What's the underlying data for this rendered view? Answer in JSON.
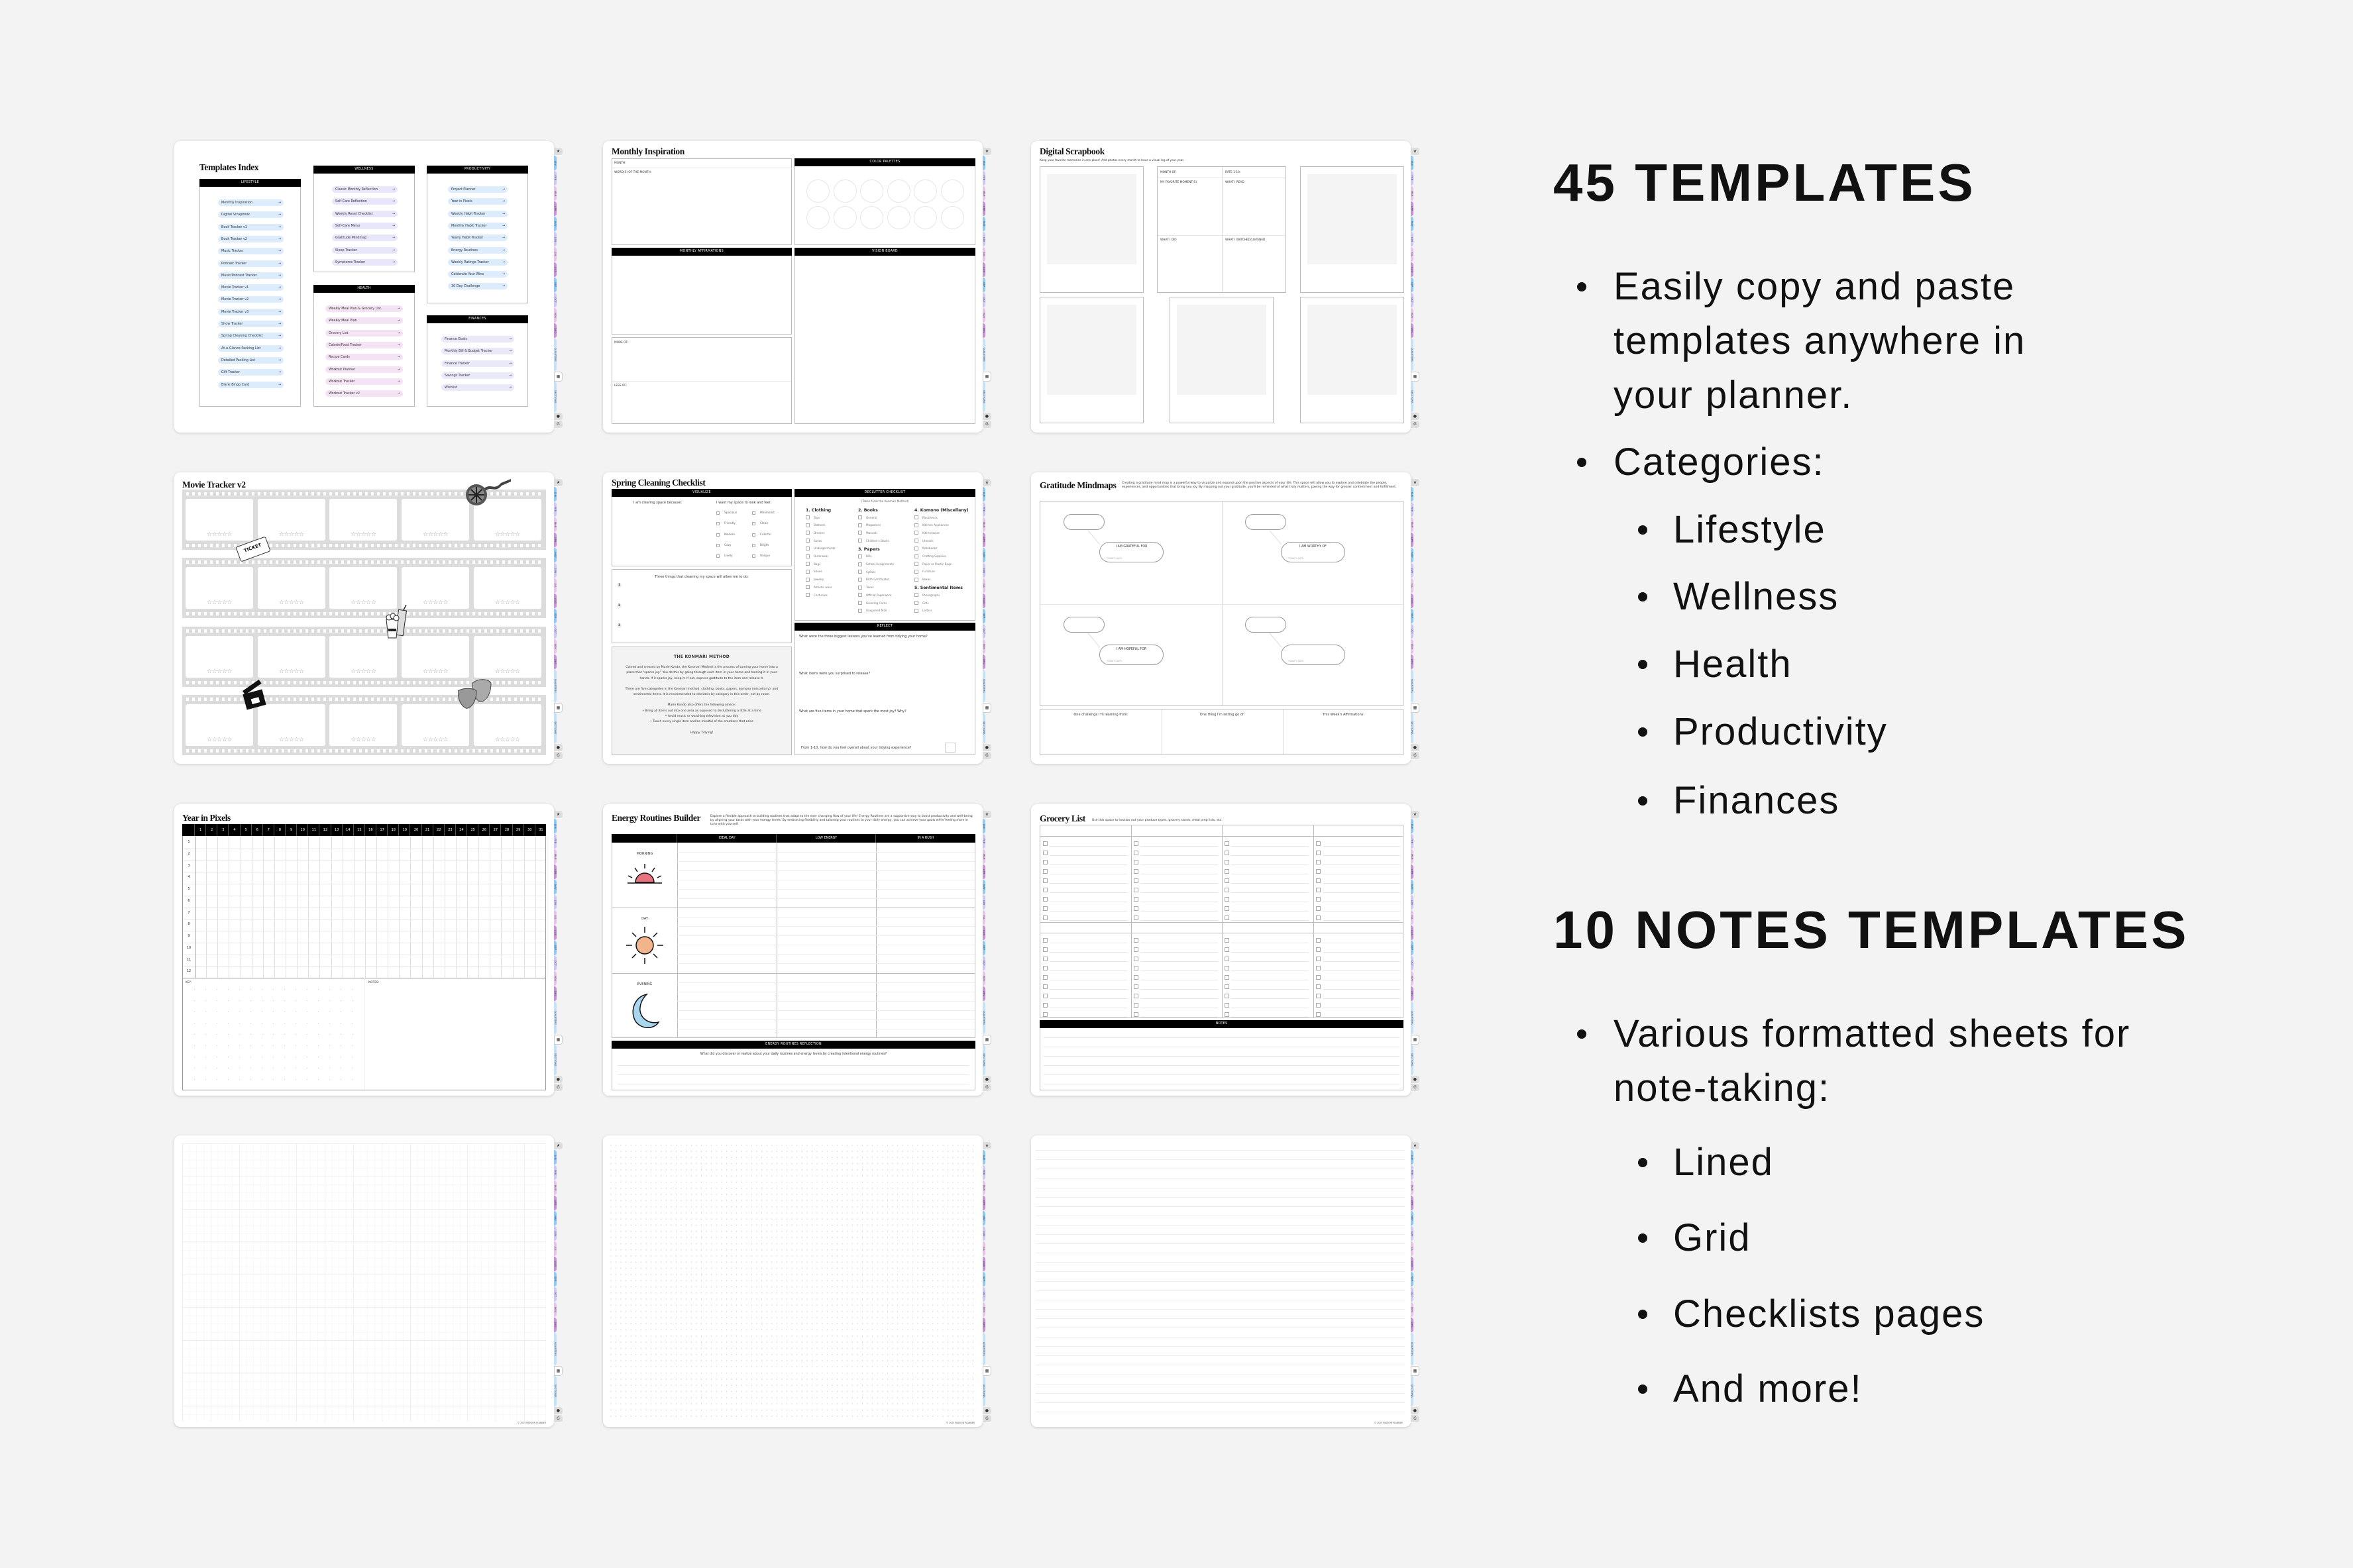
{
  "marketing": {
    "heading_templates": "45 TEMPLATES",
    "bullet_copy_paste": "Easily copy and paste templates anywhere in your planner.",
    "bullet_categories": "Categories:",
    "categories": [
      "Lifestyle",
      "Wellness",
      "Health",
      "Productivity",
      "Finances"
    ],
    "heading_notes": "10 NOTES TEMPLATES",
    "bullet_notes": "Various formatted sheets for note-taking:",
    "notes_types": [
      "Lined",
      "Grid",
      "Checklists pages",
      "And more!"
    ]
  },
  "page_tabs": [
    {
      "label": "",
      "icon": "star-icon",
      "glyph": "★",
      "color": "#dedede"
    },
    {
      "label": "JAN",
      "color": "#8fc9f4"
    },
    {
      "label": "FEB",
      "color": "#cdc8f6"
    },
    {
      "label": "MAR",
      "color": "#e7c4e8"
    },
    {
      "label": "APR",
      "color": "#c892d8"
    },
    {
      "label": "MAY",
      "color": "#8fc9f4"
    },
    {
      "label": "JUN",
      "color": "#cdc8f6"
    },
    {
      "label": "JUL",
      "color": "#e7c4e8"
    },
    {
      "label": "AUG",
      "color": "#c892d8"
    },
    {
      "label": "SEP",
      "color": "#8fc9f4"
    },
    {
      "label": "OCT",
      "color": "#cdc8f6"
    },
    {
      "label": "NOV",
      "color": "#e7c4e8"
    },
    {
      "label": "DEC",
      "color": "#c892d8"
    },
    {
      "label": "QUARTERS",
      "color": "#c4e2f8"
    },
    {
      "label": "",
      "icon": "table-icon",
      "glyph": "▦",
      "color": "#ffffff"
    },
    {
      "label": "SECTIONS",
      "color": "#c4e2f8"
    },
    {
      "label": "",
      "icon": "apple-icon",
      "glyph": "●",
      "color": "#dedede"
    },
    {
      "label": "",
      "icon": "google-icon",
      "glyph": "G",
      "color": "#dedede"
    }
  ],
  "templates_index": {
    "title": "Templates Index",
    "sections": [
      {
        "name": "LIFESTYLE",
        "color": "#dcecfc",
        "items": [
          "Monthly Inspiration",
          "Digital Scrapbook",
          "Book Tracker v1",
          "Book Tracker v2",
          "Music Tracker",
          "Podcast Tracker",
          "Music/Podcast Tracker",
          "Movie Tracker v1",
          "Movie Tracker v2",
          "Movie Tracker v3",
          "Show Tracker",
          "Spring Cleaning Checklist",
          "At-a-Glance Packing List",
          "Detailed Packing List",
          "Gift Tracker",
          "Blank Bingo Card"
        ]
      },
      {
        "name": "WELLNESS",
        "color": "#e8e6fb",
        "items": [
          "Classic Monthly Reflection",
          "Self-Care Reflection",
          "Weekly Reset Checklist",
          "Self-Care Menu",
          "Gratitude Mindmap",
          "Sleep Tracker",
          "Symptoms Tracker"
        ]
      },
      {
        "name": "HEALTH",
        "color": "#f4e3f4",
        "items": [
          "Weekly Meal Plan & Grocery List",
          "Weekly Meal Plan",
          "Grocery List",
          "Calorie/Food Tracker",
          "Recipe Cards",
          "Workout Planner",
          "Workout Tracker",
          "Workout Tracker v2"
        ]
      },
      {
        "name": "PRODUCTIVITY",
        "color": "#dcecfc",
        "items": [
          "Project Planner",
          "Year in Pixels",
          "Weekly Habit Tracker",
          "Monthly Habit Tracker",
          "Yearly Habit Tracker",
          "Energy Routines",
          "Weekly Ratings Tracker",
          "Celebrate Your Wins",
          "30 Day Challenge"
        ]
      },
      {
        "name": "FINANCES",
        "color": "#e9e9fa",
        "items": [
          "Finance Goals",
          "Monthly Bill & Budget Tracker",
          "Finance Tracker",
          "Savings Tracker",
          "Wishlist"
        ]
      }
    ]
  },
  "monthly_inspiration": {
    "title": "Monthly Inspiration",
    "month_label": "MONTH:",
    "words_label": "WORD(S) OF THE MONTH:",
    "palettes_header": "COLOR PALETTES",
    "affirmations_header": "MONTHLY AFFIRMATIONS",
    "vision_header": "VISION BOARD",
    "more_label": "MORE OF:",
    "less_label": "LESS OF:"
  },
  "digital_scrapbook": {
    "title": "Digital Scrapbook",
    "subtitle": "Keep your favorite memories in one place! Add photos every month to have a visual log of your year.",
    "month_of": "MONTH OF:",
    "rate": "RATE 1-10:",
    "favorite": "MY FAVORITE MOMENT(S)",
    "read": "WHAT I READ",
    "did": "WHAT I DID",
    "watched": "WHAT I WATCHED/LISTENED"
  },
  "movie_tracker": {
    "title": "Movie Tracker v2",
    "ticket_label": "TICKET",
    "stars": "☆☆☆☆☆"
  },
  "spring_cleaning": {
    "title": "Spring Cleaning Checklist",
    "visualize_header": "VISUALIZE",
    "clearing_prompt": "I am clearing space because:",
    "look_prompt": "I want my space to look and feel:",
    "feel_options": [
      "Spacious",
      "Minimalist",
      "Friendly",
      "Clean",
      "Modern",
      "Colorful",
      "Cozy",
      "Bright",
      "Lively",
      "Unique"
    ],
    "three_things_prompt": "Three things that cleaning my space will allow me to do:",
    "numbers": [
      "1",
      "2",
      "3"
    ],
    "konmari_title": "THE KONMARI METHOD",
    "konmari_paragraphs": [
      "Coined and created by Marie Kondo, the Konmari Method is the process of turning your home into a place that \"sparks joy.\" You do this by going through each item in your home and holding it in your hands. If it sparks joy, keep it. If not, express gratitude to the item and release it.",
      "There are five categories in the Konmari method: clothing, books, papers, komono (miscellany), and sentimental items. It is recommended to declutter by category in this order, not by room.",
      "Marie Kondo also offers the following advice:\n• Bring all items out into one area as opposed to decluttering a little at a time\n• Avoid music or watching television as you tidy\n• Touch every single item and be mindful of the emotions that arise",
      "Happy Tidying!"
    ],
    "declutter_header": "DECLUTTER CHECKLIST",
    "declutter_note": "(Taken from the Konmari Method)",
    "categories": [
      {
        "name": "1. Clothing",
        "items": [
          "Tops",
          "Bottoms",
          "Dresses",
          "Socks",
          "Undergarments",
          "Outerwear",
          "Bags",
          "Shoes",
          "Jewelry",
          "Athletic wear",
          "Costumes"
        ]
      },
      {
        "name": "2. Books",
        "items": [
          "General",
          "Magazines",
          "Manuals",
          "Children's Books"
        ]
      },
      {
        "name": "3. Papers",
        "items": [
          "Bills",
          "School Assignments",
          "Syllabi",
          "Birth Certificates",
          "Taxes",
          "Official Paperwork",
          "Greeting Cards",
          "Unopened Mail"
        ]
      },
      {
        "name": "4. Komono (Miscellany)",
        "items": [
          "Electronics",
          "Kitchen Appliances",
          "Kitchenware",
          "Utensils",
          "Notebooks",
          "Crafting Supplies",
          "Paper or Plastic Bags",
          "Furniture",
          "Boxes"
        ]
      },
      {
        "name": "5. Sentimental Items",
        "items": [
          "Photographs",
          "Gifts",
          "Letters"
        ]
      }
    ],
    "reflect_header": "REFLECT",
    "reflect_questions": [
      "What were the three biggest lessons you've learned from tidying your home?",
      "What items were you surprised to release?",
      "What are five items in your home that spark the most joy? Why?",
      "From 1-10, how do you feel overall about your tidying experience?"
    ]
  },
  "gratitude": {
    "title": "Gratitude Mindmaps",
    "description": "Creating a gratitude mind map is a powerful way to visualize and expand upon the positive aspects of your life. This space will allow you to explore and celebrate the people, experiences, and opportunities that bring you joy. By mapping out your gratitude, you'll be reminded of what truly matters, paving the way for greater contentment and fulfillment.",
    "bubbles": [
      "I AM GRATEFUL FOR",
      "I AM WORTHY OF",
      "I AM HOPEFUL FOR",
      ""
    ],
    "date_label": "TODAY'S DATE:",
    "bottom_prompts": [
      "One challenge I'm learning from:",
      "One thing I'm letting go of:",
      "This Week's Affirmations:"
    ]
  },
  "year_in_pixels": {
    "title": "Year in Pixels",
    "days": [
      "1",
      "2",
      "3",
      "4",
      "5",
      "6",
      "7",
      "8",
      "9",
      "10",
      "11",
      "12",
      "13",
      "14",
      "15",
      "16",
      "17",
      "18",
      "19",
      "20",
      "21",
      "22",
      "23",
      "24",
      "25",
      "26",
      "27",
      "28",
      "29",
      "30",
      "31"
    ],
    "months": [
      "1",
      "2",
      "3",
      "4",
      "5",
      "6",
      "7",
      "8",
      "9",
      "10",
      "11",
      "12"
    ],
    "key_label": "KEY:",
    "notes_label": "NOTES:"
  },
  "energy_routines": {
    "title": "Energy Routines Builder",
    "description": "Explore a flexible approach to building routines that adapt to the ever changing flow of your life! Energy Routines are a supportive way to boost productivity and well-being by aligning your tasks with your energy levels. By embracing flexibility and tailoring your routines to your daily energy, you can achieve your goals while feeling more in tune with yourself.",
    "columns": [
      "IDEAL DAY",
      "LOW ENERGY",
      "IN A RUSH"
    ],
    "rows": [
      {
        "label": "MORNING",
        "icon": "sunrise-icon",
        "color": "#e8737f"
      },
      {
        "label": "DAY",
        "icon": "sun-icon",
        "color": "#f2b48a"
      },
      {
        "label": "EVENING",
        "icon": "moon-icon",
        "color": "#a9d6ee"
      }
    ],
    "reflection_header": "ENERGY ROUTINES REFLECTION",
    "reflection_prompt": "What did you discover or realize about your daily routines and energy levels by creating intentional energy routines?"
  },
  "grocery_list": {
    "title": "Grocery List",
    "description": "Use this space to section out your produce types, grocery stores, meal prep lists, etc.",
    "notes_header": "NOTES"
  },
  "notes_pages": {
    "footer": "© 2025 PASSION PLANNER"
  }
}
